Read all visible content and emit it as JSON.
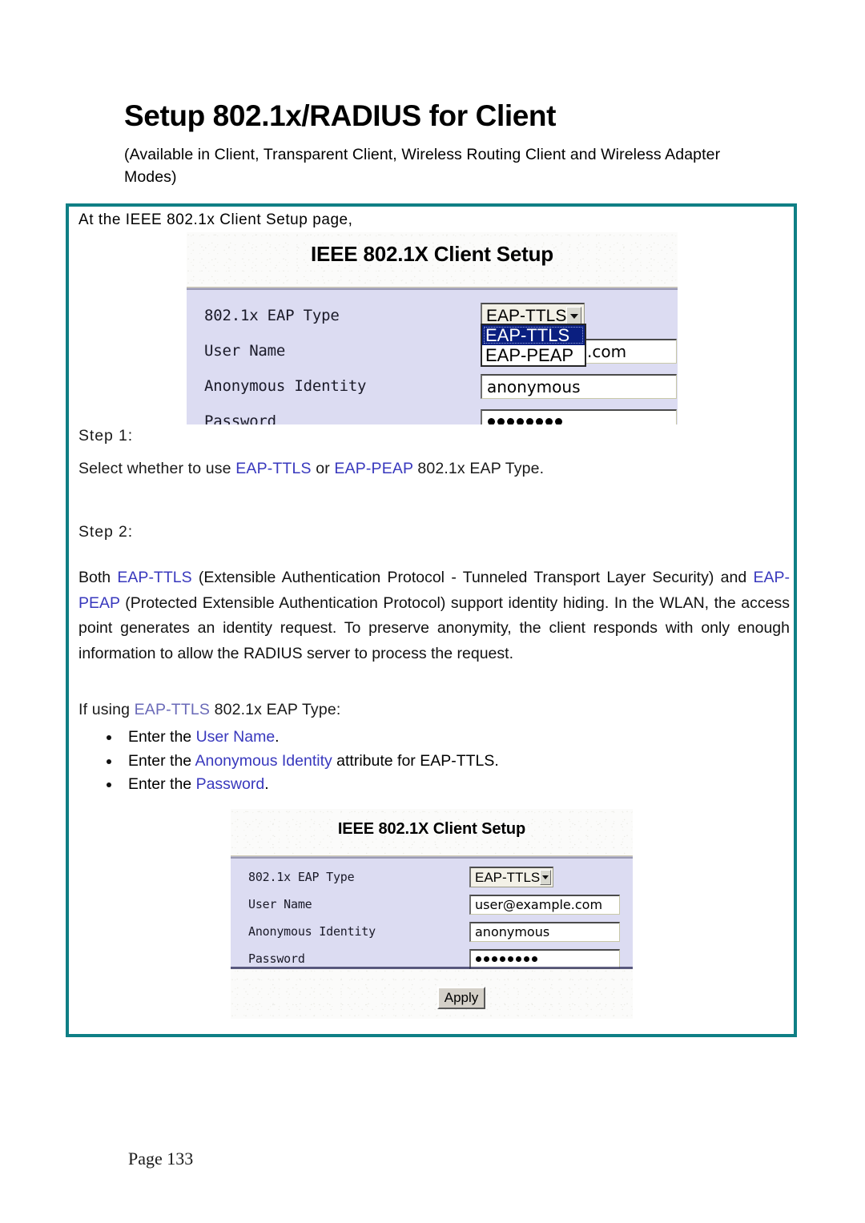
{
  "heading": {
    "title": "Setup 802.1x/RADIUS for Client",
    "subtitle": "(Available in Client, Transparent Client, Wireless Routing Client and Wireless Adapter Modes)"
  },
  "intro": "At the IEEE 802.1x Client Setup page,",
  "screenshot_open": {
    "header": "IEEE 802.1X Client Setup",
    "fields": {
      "eap_type_label": "802.1x EAP Type",
      "eap_type_value": "EAP-TTLS",
      "user_name_label": "User Name",
      "user_name_value": ".com",
      "anonymous_identity_label": "Anonymous Identity",
      "anonymous_identity_value": "anonymous",
      "password_label": "Password",
      "password_value": "••••••••"
    },
    "dropdown": {
      "open": true,
      "options": [
        "EAP-TTLS",
        "EAP-PEAP"
      ],
      "selected": "EAP-TTLS"
    }
  },
  "steps": {
    "step1_label": "Step 1:",
    "step1_text_a": "Select whether to use ",
    "step1_kw_a": "EAP-TTLS",
    "step1_text_b": " or ",
    "step1_kw_b": "EAP-PEAP",
    "step1_text_c": " 802.1x EAP Type.",
    "step2_label": "Step 2:",
    "step2_p_a": "Both ",
    "step2_kw_a": "EAP-TTLS",
    "step2_p_b": " (Extensible Authentication Protocol - Tunneled Transport Layer Security) and ",
    "step2_kw_b": "EAP-PEAP",
    "step2_p_c": " (Protected Extensible Authentication Protocol) support identity hiding. In the WLAN, the access point generates an identity request. To preserve anonymity, the client responds with only enough information to allow the RADIUS server to process the request."
  },
  "if_using": {
    "prefix": "If using ",
    "keyword": "EAP-TTLS",
    "suffix": " 802.1x EAP Type:"
  },
  "bullets": [
    {
      "prefix": "Enter the ",
      "keyword": "User Name",
      "suffix": "."
    },
    {
      "prefix": "Enter the ",
      "keyword": "Anonymous Identity",
      "suffix": " attribute for EAP-TTLS."
    },
    {
      "prefix": "Enter the ",
      "keyword": "Password",
      "suffix": "."
    }
  ],
  "screenshot_filled": {
    "header": "IEEE 802.1X Client Setup",
    "fields": {
      "eap_type_label": "802.1x EAP Type",
      "eap_type_value": "EAP-TTLS",
      "user_name_label": "User Name",
      "user_name_value": "user@example.com",
      "anonymous_identity_label": "Anonymous Identity",
      "anonymous_identity_value": "anonymous",
      "password_label": "Password",
      "password_value": "••••••••"
    },
    "apply_label": "Apply"
  },
  "footer": {
    "page": "Page 133"
  },
  "colors": {
    "box_border": "#0f7f85",
    "panel_bg": "#dcdcf2",
    "keyword": "#3838bd",
    "dropdown_highlight": "#0a1f80"
  }
}
